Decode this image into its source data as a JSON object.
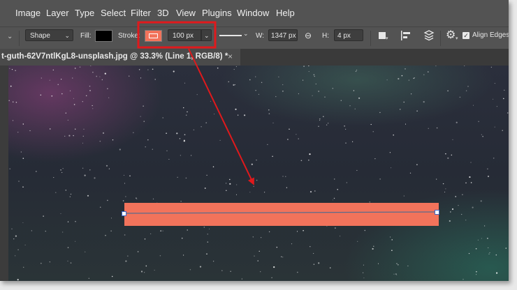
{
  "menu": [
    "Image",
    "Layer",
    "Type",
    "Select",
    "Filter",
    "3D",
    "View",
    "Plugins",
    "Window",
    "Help"
  ],
  "options": {
    "mode_value": "Shape",
    "fill_label": "Fill:",
    "stroke_label": "Stroke:",
    "stroke_width_value": "100 px",
    "w_label": "W:",
    "w_value": "1347 px",
    "h_label": "H:",
    "h_value": "4 px",
    "align_edges_label": "Align Edges",
    "fill_color": "#000000",
    "stroke_color": "#f2735b"
  },
  "document_tab": {
    "title": "t-guth-62V7ntlKgL8-unsplash.jpg @ 33.3% (Line 1, RGB/8) *",
    "close": "×"
  },
  "annotation_color": "#e0191c"
}
